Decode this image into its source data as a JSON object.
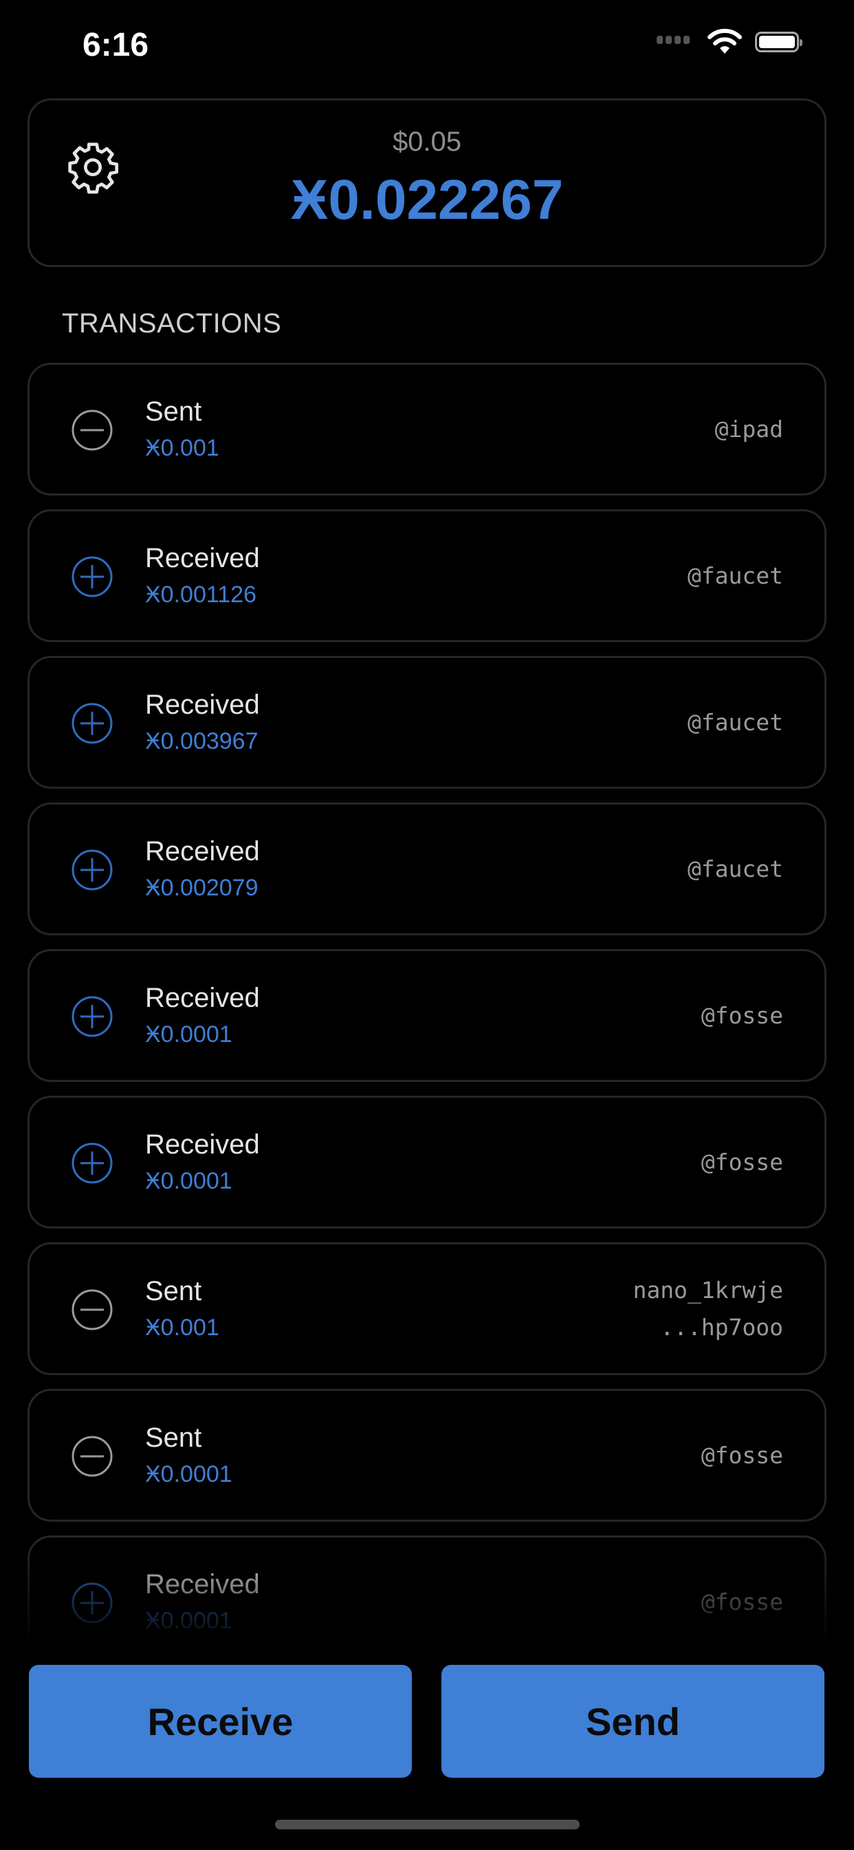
{
  "status_bar": {
    "time": "6:16"
  },
  "header": {
    "fiat_balance": "$0.05",
    "balance": "Ӿ0.022267",
    "settings_icon": "gear-icon"
  },
  "section_title": "TRANSACTIONS",
  "colors": {
    "accent": "#3f7fd6",
    "background": "#000000",
    "border": "#262626"
  },
  "transactions": [
    {
      "type": "sent",
      "title": "Sent",
      "amount": "Ӿ0.001",
      "peer": [
        "@ipad"
      ]
    },
    {
      "type": "received",
      "title": "Received",
      "amount": "Ӿ0.001126",
      "peer": [
        "@faucet"
      ]
    },
    {
      "type": "received",
      "title": "Received",
      "amount": "Ӿ0.003967",
      "peer": [
        "@faucet"
      ]
    },
    {
      "type": "received",
      "title": "Received",
      "amount": "Ӿ0.002079",
      "peer": [
        "@faucet"
      ]
    },
    {
      "type": "received",
      "title": "Received",
      "amount": "Ӿ0.0001",
      "peer": [
        "@fosse"
      ]
    },
    {
      "type": "received",
      "title": "Received",
      "amount": "Ӿ0.0001",
      "peer": [
        "@fosse"
      ]
    },
    {
      "type": "sent",
      "title": "Sent",
      "amount": "Ӿ0.001",
      "peer": [
        "nano_1krwje",
        "...hp7ooo"
      ]
    },
    {
      "type": "sent",
      "title": "Sent",
      "amount": "Ӿ0.0001",
      "peer": [
        "@fosse"
      ]
    },
    {
      "type": "received",
      "title": "Received",
      "amount": "Ӿ0.0001",
      "peer": [
        "@fosse"
      ]
    }
  ],
  "actions": {
    "receive_label": "Receive",
    "send_label": "Send"
  }
}
